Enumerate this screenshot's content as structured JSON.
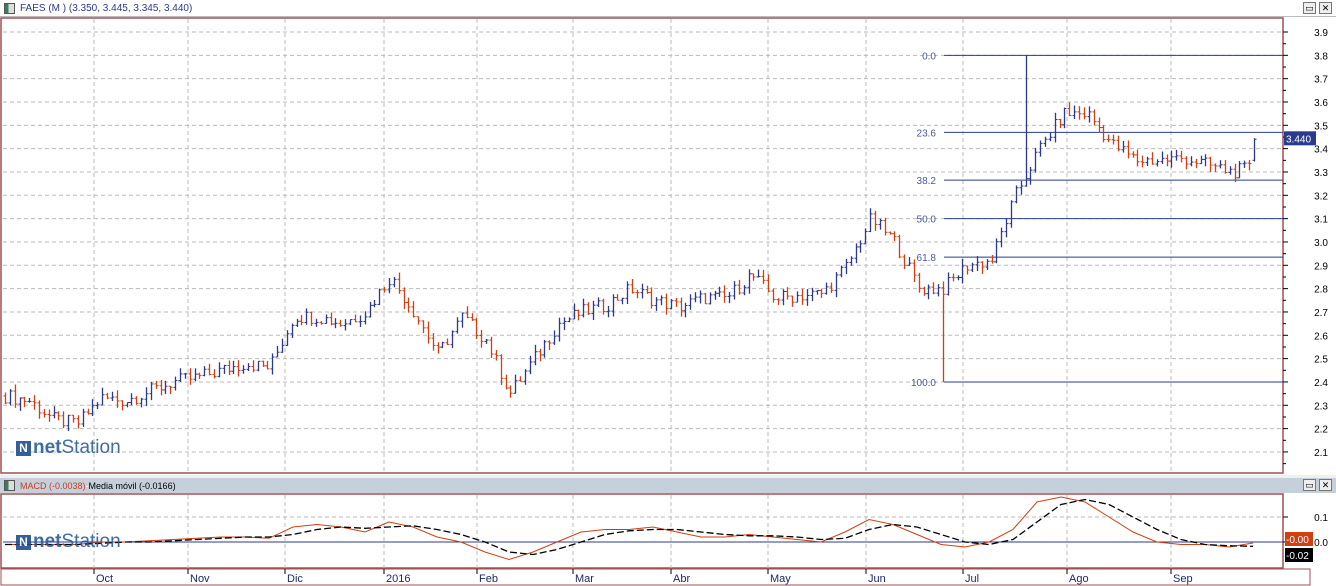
{
  "window": {
    "title": "FAES (M ) (3.350, 3.445, 3.345, 3.440)",
    "restore": "▭",
    "close": "✕"
  },
  "logo": {
    "net": "net",
    "station": "Station",
    "mark": "N"
  },
  "macd_header": {
    "macd": "MACD (-0.0038)",
    "sep": " - ",
    "signal": "Media móvil (-0.0166)"
  },
  "colors": {
    "up": "#2b3a8c",
    "down": "#d04010",
    "fib": "#2b3a8c",
    "border": "#a05050",
    "grid": "#bbbbbb",
    "macd": "#d04010",
    "signal": "#000000"
  },
  "chart_data": [
    {
      "type": "ohlc",
      "title": "FAES (M )",
      "ylim": [
        2.05,
        3.95
      ],
      "yticks": [
        "2.1",
        "2.2",
        "2.3",
        "2.4",
        "2.5",
        "2.6",
        "2.7",
        "2.8",
        "2.9",
        "3.0",
        "3.1",
        "3.2",
        "3.3",
        "3.4",
        "3.5",
        "3.6",
        "3.7",
        "3.8",
        "3.9"
      ],
      "weekly_closes": [
        2.34,
        2.32,
        2.24,
        2.22,
        2.33,
        2.32,
        2.36,
        2.4,
        2.42,
        2.45,
        2.48,
        2.46,
        2.68,
        2.68,
        2.65,
        2.7,
        2.85,
        2.7,
        2.52,
        2.68,
        2.58,
        2.35,
        2.5,
        2.65,
        2.7,
        2.73,
        2.8,
        2.75,
        2.72,
        2.76,
        2.76,
        2.86,
        2.76,
        2.77,
        2.78,
        2.9,
        3.1,
        3.0,
        2.8,
        2.8,
        2.9,
        2.92,
        3.2,
        3.4,
        3.55,
        3.55,
        3.42,
        3.35,
        3.35,
        3.36,
        3.33,
        3.3,
        3.32
      ],
      "spikes": [
        {
          "week": 39,
          "low": 2.4
        },
        {
          "week": 42.4,
          "high": 3.8
        }
      ],
      "last": {
        "open": 3.35,
        "high": 3.445,
        "low": 3.345,
        "close": 3.44,
        "label": "3.440"
      },
      "fibonacci": [
        {
          "label": "0.0",
          "value": 3.8
        },
        {
          "label": "23.6",
          "value": 3.47
        },
        {
          "label": "38.2",
          "value": 3.265
        },
        {
          "label": "50.0",
          "value": 3.1
        },
        {
          "label": "61.8",
          "value": 2.935
        },
        {
          "label": "100.0",
          "value": 2.4
        }
      ],
      "xticks": [
        "Oct",
        "Nov",
        "Dic",
        "2016",
        "Feb",
        "Mar",
        "Abr",
        "May",
        "Jun",
        "Jul",
        "Ago",
        "Sep"
      ]
    },
    {
      "type": "line",
      "title": "MACD",
      "ylim": [
        -0.05,
        0.2
      ],
      "yticks": [
        "0.1",
        "0.0"
      ],
      "series": [
        {
          "name": "MACD",
          "badge": "-0.00",
          "values": [
            -0.01,
            -0.01,
            -0.01,
            -0.01,
            0,
            0,
            0.005,
            0.01,
            0.015,
            0.02,
            0.02,
            0.015,
            0.06,
            0.07,
            0.06,
            0.04,
            0.08,
            0.06,
            0.02,
            0,
            -0.04,
            -0.07,
            -0.04,
            0,
            0.04,
            0.05,
            0.05,
            0.06,
            0.04,
            0.02,
            0.02,
            0.03,
            0.02,
            0.01,
            0,
            0.04,
            0.09,
            0.07,
            0.03,
            -0.01,
            -0.02,
            0,
            0.05,
            0.16,
            0.18,
            0.16,
            0.1,
            0.04,
            0,
            -0.01,
            -0.01,
            -0.02,
            -0.004
          ]
        },
        {
          "name": "Media móvil",
          "badge": "-0.02",
          "values": [
            -0.01,
            -0.01,
            -0.01,
            -0.01,
            -0.005,
            0,
            0,
            0.005,
            0.01,
            0.015,
            0.02,
            0.02,
            0.03,
            0.05,
            0.06,
            0.055,
            0.06,
            0.065,
            0.05,
            0.03,
            0,
            -0.04,
            -0.05,
            -0.03,
            0,
            0.03,
            0.045,
            0.05,
            0.05,
            0.04,
            0.03,
            0.025,
            0.025,
            0.02,
            0.01,
            0.015,
            0.05,
            0.07,
            0.06,
            0.03,
            0,
            -0.01,
            0.01,
            0.08,
            0.15,
            0.17,
            0.15,
            0.1,
            0.05,
            0.01,
            -0.01,
            -0.015,
            -0.017
          ]
        }
      ]
    }
  ]
}
